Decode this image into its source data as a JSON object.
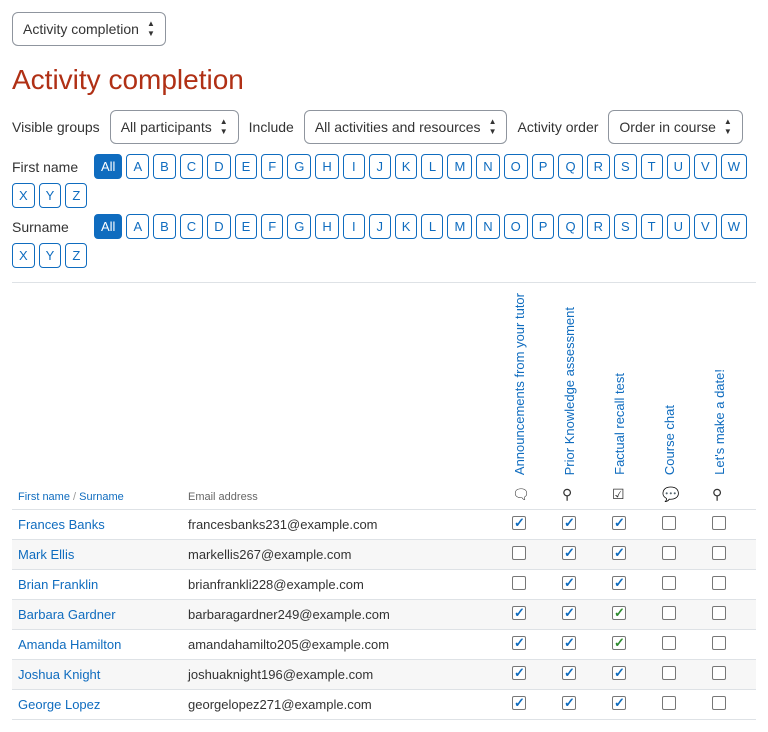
{
  "top_select": {
    "label": "Activity completion"
  },
  "title": "Activity completion",
  "filters": {
    "groups_label": "Visible groups",
    "groups_value": "All participants",
    "include_label": "Include",
    "include_value": "All activities and resources",
    "order_label": "Activity order",
    "order_value": "Order in course"
  },
  "alpha": {
    "firstname_label": "First name",
    "surname_label": "Surname",
    "all_label": "All",
    "letters": [
      "A",
      "B",
      "C",
      "D",
      "E",
      "F",
      "G",
      "H",
      "I",
      "J",
      "K",
      "L",
      "M",
      "N",
      "O",
      "P",
      "Q",
      "R",
      "S",
      "T",
      "U",
      "V",
      "W",
      "X",
      "Y",
      "Z"
    ]
  },
  "table": {
    "col_firstname": "First name",
    "col_surname": "Surname",
    "col_email": "Email address",
    "activities": [
      {
        "label": "Announcements from your tutor",
        "icon": "forum"
      },
      {
        "label": "Prior Knowledge assessment",
        "icon": "choice"
      },
      {
        "label": "Factual recall test",
        "icon": "quiz"
      },
      {
        "label": "Course chat",
        "icon": "chat"
      },
      {
        "label": "Let's make a date!",
        "icon": "choice"
      }
    ],
    "rows": [
      {
        "name": "Frances Banks",
        "email": "francesbanks231@example.com",
        "cells": [
          {
            "c": true
          },
          {
            "c": true
          },
          {
            "c": true
          },
          {
            "c": false
          },
          {
            "c": false
          }
        ]
      },
      {
        "name": "Mark Ellis",
        "email": "markellis267@example.com",
        "cells": [
          {
            "c": false
          },
          {
            "c": true
          },
          {
            "c": true
          },
          {
            "c": false
          },
          {
            "c": false
          }
        ]
      },
      {
        "name": "Brian Franklin",
        "email": "brianfrankli228@example.com",
        "cells": [
          {
            "c": false
          },
          {
            "c": true
          },
          {
            "c": true
          },
          {
            "c": false
          },
          {
            "c": false
          }
        ]
      },
      {
        "name": "Barbara Gardner",
        "email": "barbaragardner249@example.com",
        "cells": [
          {
            "c": true
          },
          {
            "c": true
          },
          {
            "c": true,
            "g": true
          },
          {
            "c": false
          },
          {
            "c": false
          }
        ]
      },
      {
        "name": "Amanda Hamilton",
        "email": "amandahamilto205@example.com",
        "cells": [
          {
            "c": true
          },
          {
            "c": true
          },
          {
            "c": true,
            "g": true
          },
          {
            "c": false
          },
          {
            "c": false
          }
        ]
      },
      {
        "name": "Joshua Knight",
        "email": "joshuaknight196@example.com",
        "cells": [
          {
            "c": true
          },
          {
            "c": true
          },
          {
            "c": true
          },
          {
            "c": false
          },
          {
            "c": false
          }
        ]
      },
      {
        "name": "George Lopez",
        "email": "georgelopez271@example.com",
        "cells": [
          {
            "c": true
          },
          {
            "c": true
          },
          {
            "c": true
          },
          {
            "c": false
          },
          {
            "c": false
          }
        ]
      }
    ]
  }
}
